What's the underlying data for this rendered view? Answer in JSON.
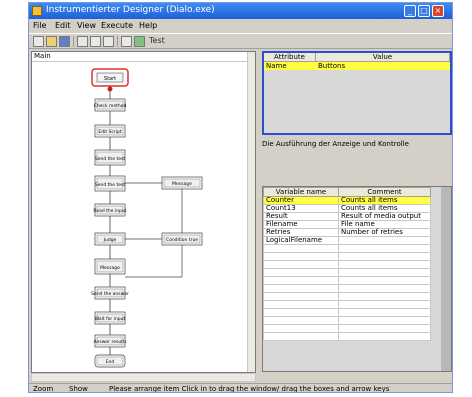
{
  "window": {
    "title": "Instrumentierter Designer (Dialo.exe)"
  },
  "menu": [
    "File",
    "Edit",
    "View",
    "Execute",
    "Help"
  ],
  "toolbar": {
    "icons": [
      "new-icon",
      "open-icon",
      "save-icon",
      "cut-icon",
      "copy-icon",
      "paste-icon",
      "undo-icon",
      "run-icon"
    ],
    "label": "Test"
  },
  "left_pane": {
    "header": "Main"
  },
  "flow": {
    "nodes": [
      "Start",
      "Check method",
      "Edit Script",
      "Send the test",
      "Send the test",
      "Read the input",
      "Judge",
      "Message",
      "Send the answer",
      "Wait for input",
      "Answer results",
      "End"
    ],
    "side_nodes": [
      "Message",
      "Condition true"
    ]
  },
  "properties": {
    "headers": [
      "Attribute name",
      "Value"
    ],
    "row": [
      "Name",
      "Buttons"
    ]
  },
  "description": "Die Ausführung der Anzeige und Kontrolle",
  "variables": {
    "headers": [
      "Variable name",
      "Comment"
    ],
    "rows": [
      [
        "Counter",
        "Counts all items",
        true
      ],
      [
        "Count13",
        "Counts all items",
        false
      ],
      [
        "Result",
        "Result of media output",
        false
      ],
      [
        "Filename",
        "File name",
        false
      ],
      [
        "Retries",
        "Number of retries",
        false
      ],
      [
        "LogicalFilename",
        "",
        false
      ],
      [
        "",
        "",
        false
      ],
      [
        "",
        "",
        false
      ],
      [
        "",
        "",
        false
      ],
      [
        "",
        "",
        false
      ],
      [
        "",
        "",
        false
      ],
      [
        "",
        "",
        false
      ],
      [
        "",
        "",
        false
      ],
      [
        "",
        "",
        false
      ],
      [
        "",
        "",
        false
      ],
      [
        "",
        "",
        false
      ],
      [
        "",
        "",
        false
      ],
      [
        "",
        "",
        false
      ]
    ]
  },
  "status": {
    "cells": [
      "Zoom",
      "Show",
      "Please arrange item Click in to drag the window/ drag the boxes and arrow keys"
    ]
  },
  "colors": {
    "accent": "#2b4fd3",
    "highlight": "#ffff40",
    "start_outline": "#e03030"
  }
}
